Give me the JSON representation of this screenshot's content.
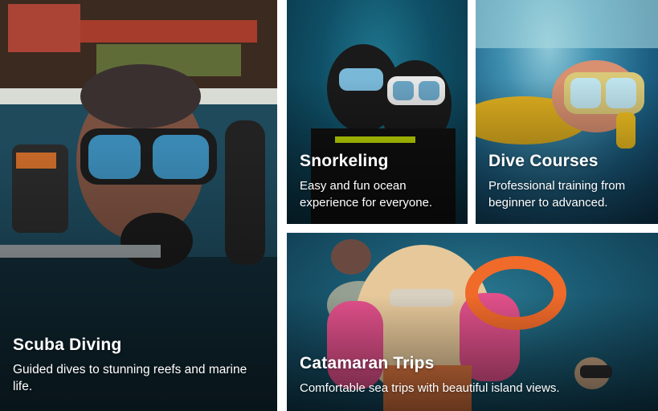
{
  "cards": [
    {
      "title": "Scuba Diving",
      "description": "Guided dives to stunning reefs and marine life."
    },
    {
      "title": "Snorkeling",
      "description": "Easy and fun ocean experience for everyone."
    },
    {
      "title": "Dive Courses",
      "description": "Professional training from beginner to advanced."
    },
    {
      "title": "Catamaran Trips",
      "description": "Comfortable sea trips with beautiful island views."
    }
  ]
}
